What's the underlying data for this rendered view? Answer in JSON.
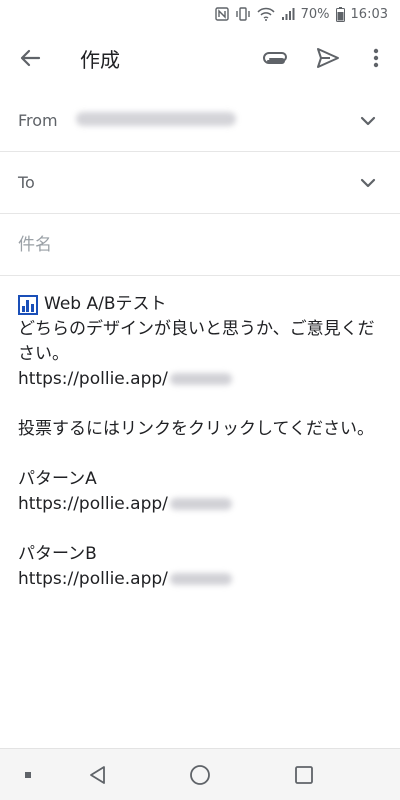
{
  "status_bar": {
    "battery_percent": "70%",
    "time": "16:03",
    "icons": [
      "nfc-icon",
      "vibrate-icon",
      "wifi-icon",
      "signal-icon",
      "battery-icon"
    ]
  },
  "app_bar": {
    "title": "作成",
    "icons": [
      "back-arrow-icon",
      "paperclip-icon",
      "send-icon",
      "more-vert-icon"
    ]
  },
  "compose": {
    "from_label": "From",
    "to_label": "To",
    "subject_placeholder": "件名",
    "subject_value": ""
  },
  "body": {
    "title": "Web A/Bテスト",
    "line1": "どちらのデザインが良いと思うか、ご意見ください。",
    "url_prefix": "https://pollie.app/",
    "instruction": "投票するにはリンクをクリックしてください。",
    "pattern_a_label": "パターンA",
    "pattern_b_label": "パターンB"
  },
  "nav_bar": {
    "icons": [
      "recents-dot-icon",
      "back-triangle-icon",
      "home-circle-icon",
      "overview-square-icon"
    ]
  },
  "colors": {
    "accent_blue": "#1a4fb8",
    "text": "#202124",
    "secondary_text": "#5f6368",
    "divider": "#e6e6e6"
  }
}
